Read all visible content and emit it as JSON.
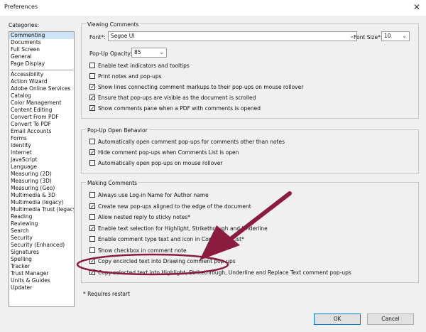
{
  "window": {
    "title": "Preferences",
    "close": "✕"
  },
  "categories": {
    "label": "Categories:",
    "top": [
      "Commenting",
      "Documents",
      "Full Screen",
      "General",
      "Page Display"
    ],
    "rest": [
      "Accessibility",
      "Action Wizard",
      "Adobe Online Services",
      "Catalog",
      "Color Management",
      "Content Editing",
      "Convert From PDF",
      "Convert To PDF",
      "Email Accounts",
      "Forms",
      "Identity",
      "Internet",
      "JavaScript",
      "Language",
      "Measuring (2D)",
      "Measuring (3D)",
      "Measuring (Geo)",
      "Multimedia & 3D",
      "Multimedia (legacy)",
      "Multimedia Trust (legacy)",
      "Reading",
      "Reviewing",
      "Search",
      "Security",
      "Security (Enhanced)",
      "Signatures",
      "Spelling",
      "Tracker",
      "Trust Manager",
      "Units & Guides",
      "Updater"
    ]
  },
  "viewing": {
    "title": "Viewing Comments",
    "font_label": "Font*:",
    "font_value": "Segoe UI",
    "fontsize_label": "Font Size*:",
    "fontsize_value": "10",
    "opacity_label": "Pop-Up Opacity:",
    "opacity_value": "85",
    "options": [
      {
        "label": "Enable text indicators and tooltips",
        "checked": false
      },
      {
        "label": "Print notes and pop-ups",
        "checked": false
      },
      {
        "label": "Show lines connecting comment markups to their pop-ups on mouse rollover",
        "checked": true
      },
      {
        "label": "Ensure that pop-ups are visible as the document is scrolled",
        "checked": true
      },
      {
        "label": "Show comments pane when a PDF with comments is opened",
        "checked": true
      }
    ]
  },
  "popup": {
    "title": "Pop-Up Open Behavior",
    "options": [
      {
        "label": "Automatically open comment pop-ups for comments other than notes",
        "checked": false
      },
      {
        "label": "Hide comment pop-ups when Comments List is open",
        "checked": true
      },
      {
        "label": "Automatically open pop-ups on mouse rollover",
        "checked": false
      }
    ]
  },
  "making": {
    "title": "Making Comments",
    "options": [
      {
        "label": "Always use Log-in Name for Author name",
        "checked": false
      },
      {
        "label": "Create new pop-ups aligned to the edge of the document",
        "checked": true
      },
      {
        "label": "Allow nested reply to sticky notes*",
        "checked": false
      },
      {
        "label": "Enable text selection for Highlight, Strikethrough and Underline",
        "checked": true
      },
      {
        "label": "Enable comment type text and icon in Comments List*",
        "checked": false
      },
      {
        "label": "Show checkbox in comment note",
        "checked": false
      },
      {
        "label": "Copy encircled text into Drawing comment pop-ups",
        "checked": true
      },
      {
        "label": "Copy selected text into Highlight, Strikethrough, Underline and Replace Text comment pop-ups",
        "checked": true
      }
    ]
  },
  "footer": {
    "note": "* Requires restart",
    "ok": "OK",
    "cancel": "Cancel"
  },
  "colors": {
    "annotation": "#8c1c3f",
    "selection": "#cfe3f6"
  }
}
